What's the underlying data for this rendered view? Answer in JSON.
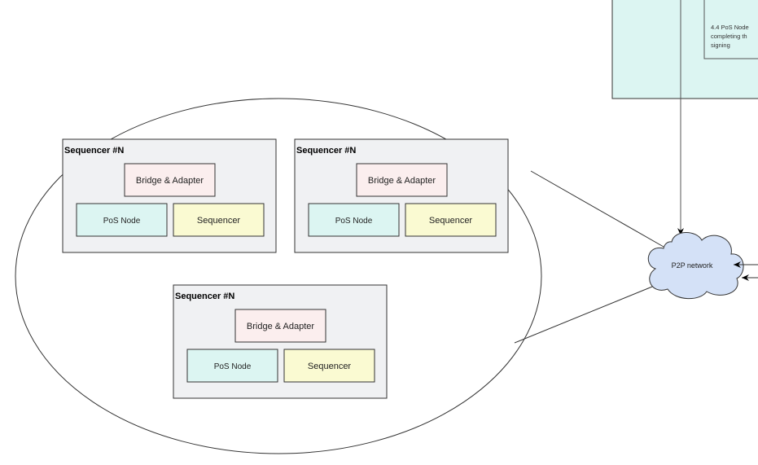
{
  "top_box": {
    "text_lines": [
      "4.4 PoS Node",
      "completing th",
      "signing"
    ]
  },
  "cloud": {
    "label": "P2P network"
  },
  "sequencers": [
    {
      "title": "Sequencer #N",
      "bridge": "Bridge & Adapter",
      "pos": "PoS Node",
      "seq": "Sequencer"
    },
    {
      "title": "Sequencer #N",
      "bridge": "Bridge & Adapter",
      "pos": "PoS Node",
      "seq": "Sequencer"
    },
    {
      "title": "Sequencer #N",
      "bridge": "Bridge & Adapter",
      "pos": "PoS Node",
      "seq": "Sequencer"
    }
  ],
  "colors": {
    "cyan": "#dcf5f2",
    "pink": "#fbeeee",
    "yellow": "#fafad2",
    "gray": "#f0f1f3",
    "cloud": "#d4e1f7"
  }
}
